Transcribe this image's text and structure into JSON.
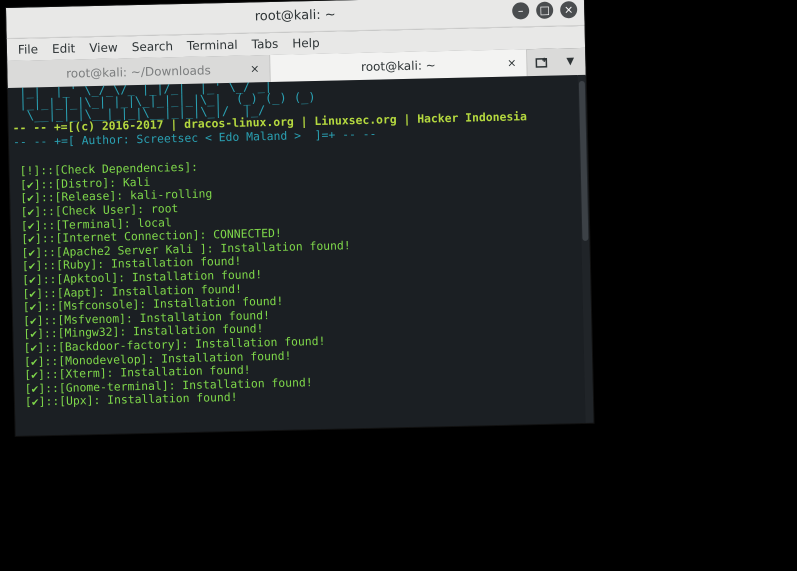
{
  "window": {
    "title": "root@kali: ~",
    "controls": {
      "minimize": "–",
      "maximize": "□",
      "close": "×"
    }
  },
  "menu": [
    "File",
    "Edit",
    "View",
    "Search",
    "Terminal",
    "Tabs",
    "Help"
  ],
  "tabs": [
    {
      "label": "root@kali: ~/Downloads",
      "active": false,
      "close": "×"
    },
    {
      "label": "root@kali: ~",
      "active": true,
      "close": "×"
    }
  ],
  "terminal": {
    "banner_art": [
      " |_|  |_' \\_/_\\/_ |_|/_|  |_' \\_/ _|",
      " |_|_|_|_|\\_| |_|\\_|_|_|_|\\_|  (_) (_) (_)",
      "  \\__|_|_|\\__|_|_|\\__|_|_|\\_|/  |_/"
    ],
    "credit_line": "-- -- +=[(c) 2016-2017 | dracos-linux.org | Linuxsec.org | Hacker Indonesia",
    "author_line": "-- -- +=[ Author: Screetsec < Edo Maland >  ]=+ -- --",
    "check_lines": [
      "[!]::[Check Dependencies]:",
      "[✔]::[Distro]: Kali",
      "[✔]::[Release]: kali-rolling",
      "[✔]::[Check User]: root",
      "[✔]::[Terminal]: local",
      "[✔]::[Internet Connection]: CONNECTED!",
      "[✔]::[Apache2 Server Kali ]: Installation found!",
      "[✔]::[Ruby]: Installation found!",
      "[✔]::[Apktool]: Installation found!",
      "[✔]::[Aapt]: Installation found!",
      "[✔]::[Msfconsole]: Installation found!",
      "[✔]::[Msfvenom]: Installation found!",
      "[✔]::[Mingw32]: Installation found!",
      "[✔]::[Backdoor-factory]: Installation found!",
      "[✔]::[Monodevelop]: Installation found!",
      "[✔]::[Xterm]: Installation found!",
      "[✔]::[Gnome-terminal]: Installation found!",
      "[✔]::[Upx]: Installation found!"
    ]
  },
  "colors": {
    "terminal_bg": "#1b1f23",
    "art": "#2aa1b3",
    "credit": "#b5d93f",
    "output": "#7fd84a"
  }
}
